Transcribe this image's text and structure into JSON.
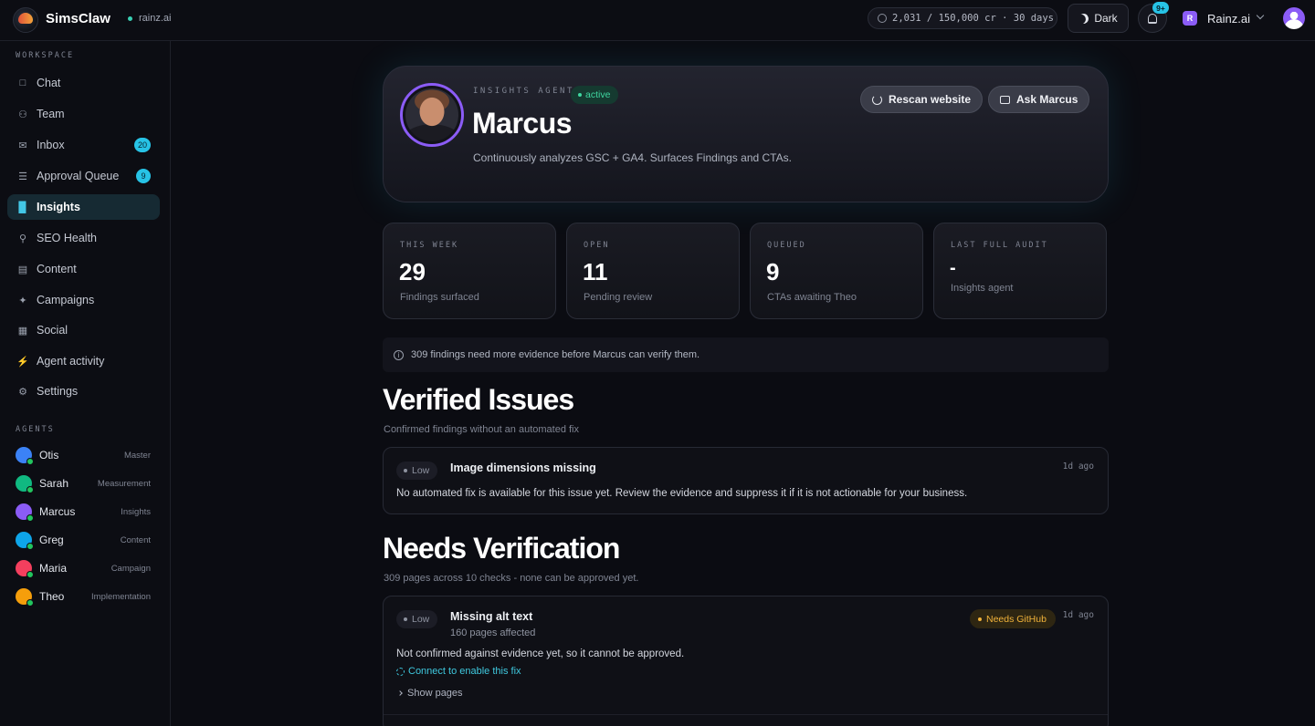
{
  "app": {
    "brand": "SimsClaw",
    "workspace": "rainz.ai",
    "credits": "2,031 / 150,000 cr · 30 days",
    "theme_label": "Dark",
    "notifications_badge": "9+",
    "org_initial": "R",
    "org_name": "Rainz.ai"
  },
  "sidebar": {
    "workspace_label": "WORKSPACE",
    "items": [
      {
        "label": "Chat",
        "icon": "chat-icon"
      },
      {
        "label": "Team",
        "icon": "team-icon"
      },
      {
        "label": "Inbox",
        "icon": "inbox-icon",
        "badge": "20"
      },
      {
        "label": "Approval Queue",
        "icon": "list-icon",
        "badge": "9"
      },
      {
        "label": "Insights",
        "icon": "bar-chart-icon",
        "active": true
      },
      {
        "label": "SEO Health",
        "icon": "search-icon"
      },
      {
        "label": "Content",
        "icon": "document-icon"
      },
      {
        "label": "Campaigns",
        "icon": "sparkle-icon"
      },
      {
        "label": "Social",
        "icon": "calendar-icon"
      },
      {
        "label": "Agent activity",
        "icon": "bolt-icon"
      },
      {
        "label": "Settings",
        "icon": "gear-icon"
      }
    ],
    "agents_label": "AGENTS",
    "agents": [
      {
        "name": "Otis",
        "role": "Master",
        "color": "#3b82f6"
      },
      {
        "name": "Sarah",
        "role": "Measurement",
        "color": "#10b981"
      },
      {
        "name": "Marcus",
        "role": "Insights",
        "color": "#8b5cf6"
      },
      {
        "name": "Greg",
        "role": "Content",
        "color": "#0ea5e9"
      },
      {
        "name": "Maria",
        "role": "Campaign",
        "color": "#f43f5e"
      },
      {
        "name": "Theo",
        "role": "Implementation",
        "color": "#f59e0b"
      }
    ]
  },
  "hero": {
    "eyebrow": "INSIGHTS AGENT",
    "status": "active",
    "name": "Marcus",
    "description": "Continuously analyzes GSC + GA4. Surfaces Findings and CTAs.",
    "rescan_label": "Rescan website",
    "ask_label": "Ask Marcus"
  },
  "stats": [
    {
      "label": "THIS WEEK",
      "value": "29",
      "sub": "Findings surfaced"
    },
    {
      "label": "OPEN",
      "value": "11",
      "sub": "Pending review"
    },
    {
      "label": "QUEUED",
      "value": "9",
      "sub": "CTAs awaiting Theo"
    },
    {
      "label": "LAST FULL AUDIT",
      "value": "-",
      "sub": "Insights agent"
    }
  ],
  "notice": "309 findings need more evidence before Marcus can verify them.",
  "verified": {
    "title": "Verified Issues",
    "subtitle": "Confirmed findings without an automated fix",
    "issues": [
      {
        "severity": "Low",
        "title": "Image dimensions missing",
        "time": "1d ago",
        "body": "No automated fix is available for this issue yet. Review the evidence and suppress it if it is not actionable for your business."
      }
    ]
  },
  "needs": {
    "title": "Needs Verification",
    "subtitle": "309 pages across 10 checks - none can be approved yet.",
    "issues": [
      {
        "severity": "Low",
        "title": "Missing alt text",
        "meta": "160 pages affected",
        "badge": "Needs GitHub",
        "time": "1d ago",
        "body": "Not confirmed against evidence yet, so it cannot be approved.",
        "fix_link": "Connect to enable this fix",
        "show_pages": "Show pages"
      }
    ]
  }
}
